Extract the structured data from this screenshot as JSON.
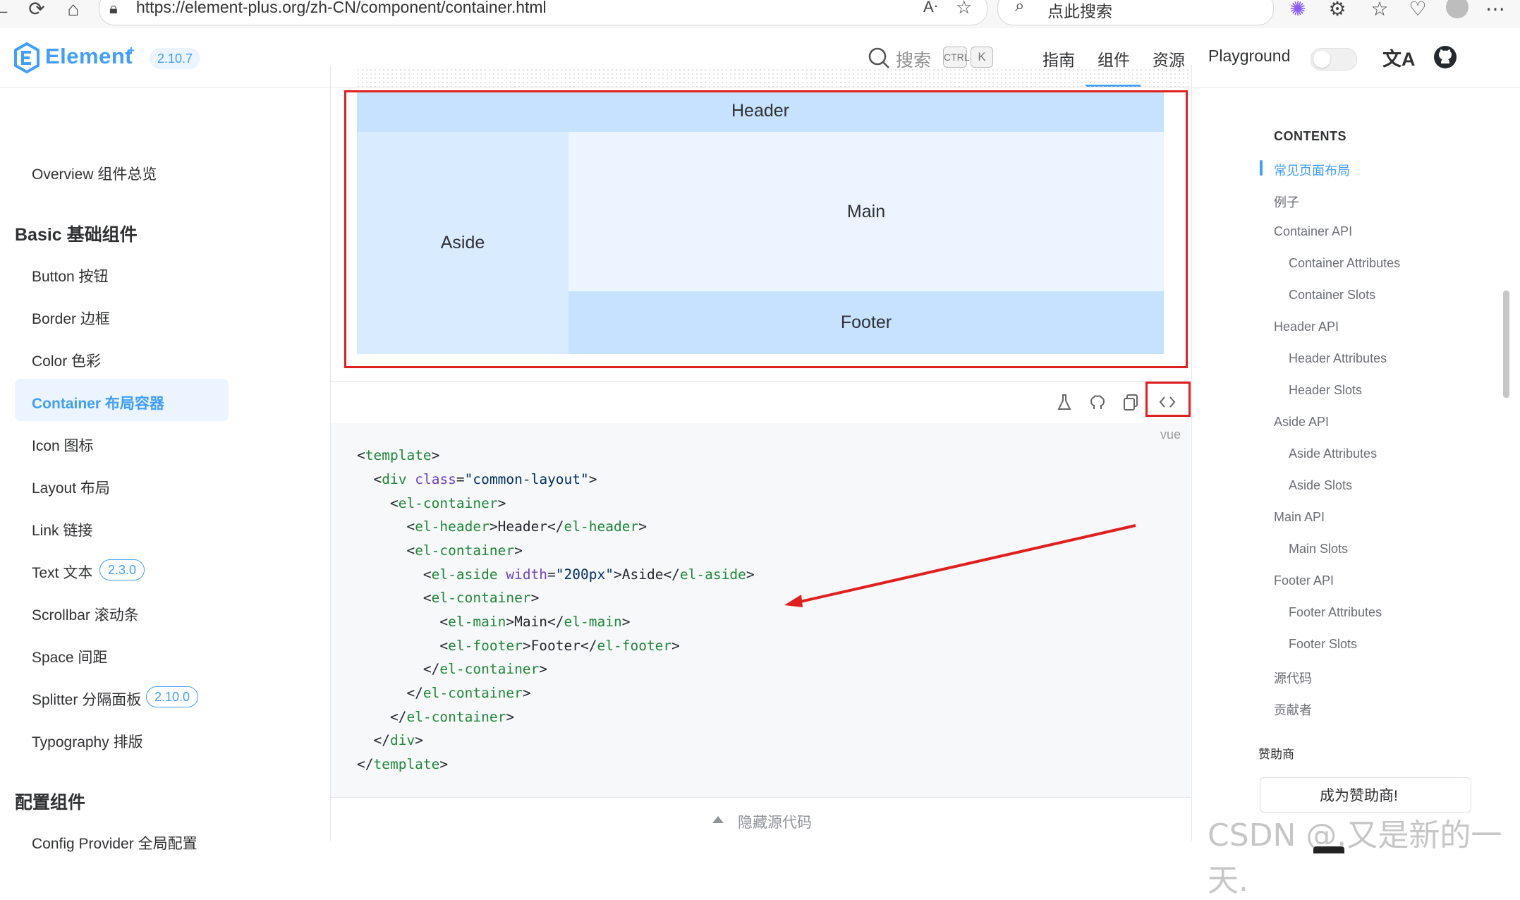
{
  "browser": {
    "url": "https://element-plus.org/zh-CN/component/container.html",
    "search_placeholder": "点此搜索"
  },
  "header": {
    "logo_text": "Element",
    "logo_sup": "+",
    "version": "2.10.7",
    "search_label": "搜索",
    "kbd_ctrl": "CTRL",
    "kbd_k": "K",
    "nav": [
      "指南",
      "组件",
      "资源",
      "Playground"
    ],
    "active_nav": "组件",
    "translate_icon": "文A"
  },
  "sidebar": {
    "overview": "Overview 组件总览",
    "group_basic": "Basic 基础组件",
    "items": [
      {
        "label": "Button 按钮"
      },
      {
        "label": "Border 边框"
      },
      {
        "label": "Color 色彩"
      },
      {
        "label": "Container 布局容器",
        "active": true
      },
      {
        "label": "Icon 图标"
      },
      {
        "label": "Layout 布局"
      },
      {
        "label": "Link 链接"
      },
      {
        "label": "Text 文本",
        "badge": "2.3.0"
      },
      {
        "label": "Scrollbar 滚动条"
      },
      {
        "label": "Space 间距"
      },
      {
        "label": "Splitter 分隔面板",
        "badge": "2.10.0"
      },
      {
        "label": "Typography 排版"
      }
    ],
    "group_config": "配置组件",
    "config_provider": "Config Provider 全局配置"
  },
  "demo": {
    "header": "Header",
    "aside": "Aside",
    "main": "Main",
    "footer": "Footer",
    "code_lang": "vue",
    "hide_source": "隐藏源代码"
  },
  "code": {
    "template_open": "template",
    "div_tag": "div",
    "class_attr": "class",
    "class_value": "\"common-layout\"",
    "el_container": "el-container",
    "el_header": "el-header",
    "header_text": "Header",
    "el_aside": "el-aside",
    "width_attr": "width",
    "width_value": "\"200px\"",
    "aside_text": "Aside",
    "el_main": "el-main",
    "main_text": "Main",
    "el_footer": "el-footer",
    "footer_text": "Footer"
  },
  "toc": {
    "title": "CONTENTS",
    "items": [
      {
        "label": "常见页面布局",
        "active": true
      },
      {
        "label": "例子"
      },
      {
        "label": "Container API"
      },
      {
        "label": "Container Attributes"
      },
      {
        "label": "Container Slots"
      },
      {
        "label": "Header API"
      },
      {
        "label": "Header Attributes"
      },
      {
        "label": "Header Slots"
      },
      {
        "label": "Aside API"
      },
      {
        "label": "Aside Attributes"
      },
      {
        "label": "Aside Slots"
      },
      {
        "label": "Main API"
      },
      {
        "label": "Main Slots"
      },
      {
        "label": "Footer API"
      },
      {
        "label": "Footer Attributes"
      },
      {
        "label": "Footer Slots"
      },
      {
        "label": "源代码"
      },
      {
        "label": "贡献者"
      }
    ],
    "sponsors_label": "赞助商",
    "sponsor_button": "成为赞助商!"
  },
  "watermark": "CSDN @.又是新的一天.",
  "colors": {
    "brand": "#409eff",
    "header_block": "#c6e2ff",
    "aside_block": "#d9ecff",
    "main_block": "#ecf5ff",
    "annotation": "#e02020"
  }
}
